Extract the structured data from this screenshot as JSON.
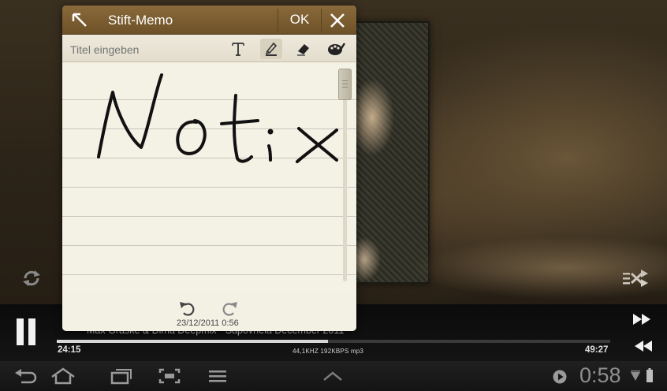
{
  "memo": {
    "title": "Stift-Memo",
    "ok_label": "OK",
    "title_placeholder": "Titel eingeben",
    "handwritten_text": "Notix",
    "date": "23/12/2011 0:56",
    "tools": [
      "text-tool-icon",
      "pen-tool-icon",
      "eraser-tool-icon",
      "palette-tool-icon"
    ],
    "selected_tool": "pen"
  },
  "player": {
    "track_title": "Max Graske & Dima Deepmix - Sapovnela December 2011",
    "time_current": "24:15",
    "time_total": "49:27",
    "audio_info": "44,1KHZ  192KBPS  mp3",
    "progress": 0.49,
    "state": "playing"
  },
  "system": {
    "clock": "0:58"
  }
}
